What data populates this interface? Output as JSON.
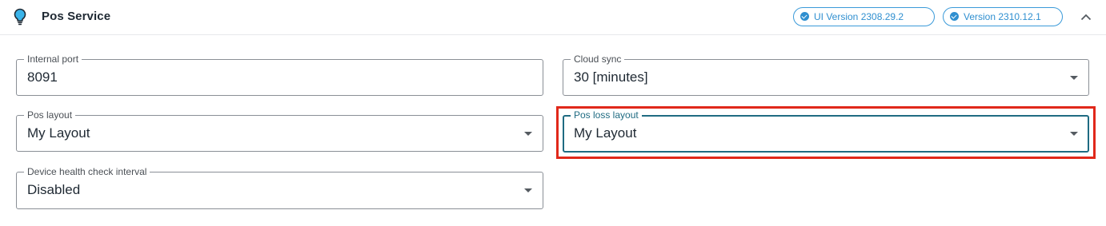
{
  "header": {
    "icon": "lightbulb-icon",
    "title": "Pos Service",
    "badges": [
      {
        "label": "UI Version 2308.29.2",
        "icon": "check-circle-icon"
      },
      {
        "label": "Version 2310.12.1",
        "icon": "check-circle-icon"
      }
    ],
    "collapse_icon": "chevron-up-icon"
  },
  "fields": {
    "internal_port": {
      "label": "Internal port",
      "value": "8091"
    },
    "cloud_sync": {
      "label": "Cloud sync",
      "value": "30 [minutes]"
    },
    "pos_layout": {
      "label": "Pos layout",
      "value": "My Layout"
    },
    "pos_loss_layout": {
      "label": "Pos loss layout",
      "value": "My Layout"
    },
    "device_health": {
      "label": "Device health check interval",
      "value": "Disabled"
    }
  },
  "colors": {
    "accent": "#1f6b82",
    "badge": "#2f8fd0",
    "highlight": "#e0281a"
  }
}
